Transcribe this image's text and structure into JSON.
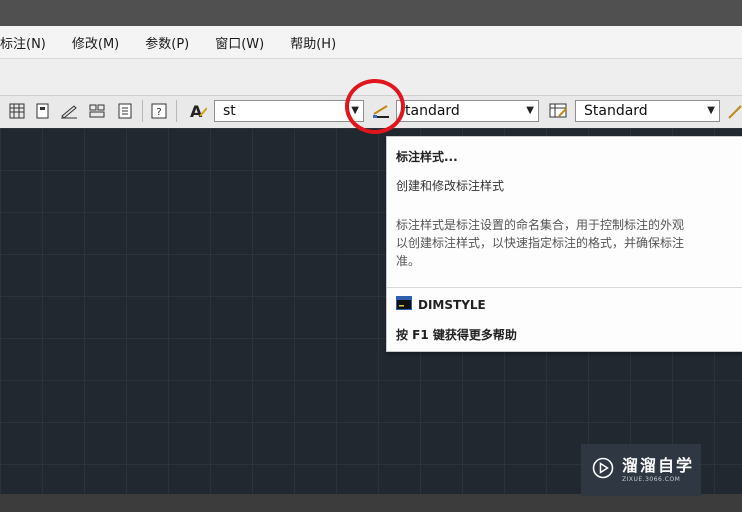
{
  "menubar": {
    "items": [
      "标注(N)",
      "修改(M)",
      "参数(P)",
      "窗口(W)",
      "帮助(H)"
    ]
  },
  "toolbar": {
    "text_style_value": "st",
    "dim_style_value": "tandard",
    "table_style_value": "Standard"
  },
  "tooltip": {
    "title": "标注样式...",
    "subtitle": "创建和修改标注样式",
    "description_lines": [
      "标注样式是标注设置的命名集合，用于控制标注的外观",
      "以创建标注样式，以快速指定标注的格式，并确保标注",
      "准。"
    ],
    "command": "DIMSTYLE",
    "help": "按 F1 键获得更多帮助"
  },
  "watermark": {
    "name": "溜溜自学",
    "url": "ZIXUE.3066.COM"
  },
  "colors": {
    "highlight": "#e1151d",
    "canvas": "#212830"
  }
}
